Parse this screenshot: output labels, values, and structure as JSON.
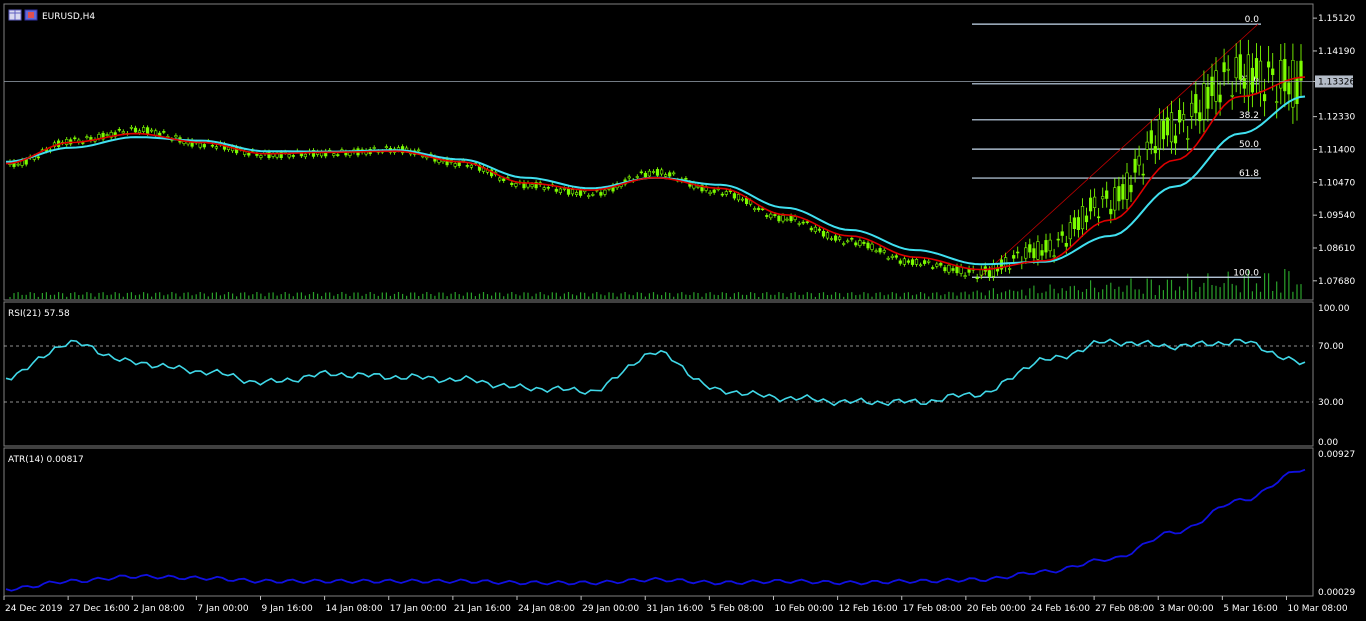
{
  "header": {
    "symbol_label": "EURUSD,H4"
  },
  "colors": {
    "background": "#000000",
    "panel_border": "#808080",
    "candle": "#7CFC00",
    "ma_fast": "#e00000",
    "ma_slow": "#40e0f0",
    "fib": "#c8dcf0",
    "fib_trend": "#c00000",
    "rsi": "#40d8e8",
    "atr": "#1010e0",
    "volume": "#2aa02a"
  },
  "price_panel": {
    "price_ticks": [
      "1.15120",
      "1.14190",
      "1.13326",
      "1.12330",
      "1.11400",
      "1.10470",
      "1.09540",
      "1.08610",
      "1.07680"
    ],
    "current_price": "1.13326",
    "fibonacci_levels": [
      {
        "label": "0.0",
        "price": 1.1495
      },
      {
        "label": "23.6",
        "price": 1.1326
      },
      {
        "label": "38.2",
        "price": 1.1224
      },
      {
        "label": "50.0",
        "price": 1.1141
      },
      {
        "label": "61.8",
        "price": 1.1059
      },
      {
        "label": "100.0",
        "price": 1.0778
      }
    ]
  },
  "rsi_panel": {
    "label": "RSI(21) 57.58",
    "ticks": [
      "100.00",
      "70.00",
      "30.00",
      "0.00"
    ],
    "levels": [
      70,
      30
    ]
  },
  "atr_panel": {
    "label": "ATR(14) 0.00817",
    "ticks": [
      "0.00927",
      "0.00029"
    ]
  },
  "time_axis": {
    "labels": [
      "24 Dec 2019",
      "27 Dec 16:00",
      "2 Jan 08:00",
      "7 Jan 00:00",
      "9 Jan 16:00",
      "14 Jan 08:00",
      "17 Jan 00:00",
      "21 Jan 16:00",
      "24 Jan 08:00",
      "29 Jan 00:00",
      "31 Jan 16:00",
      "5 Feb 08:00",
      "10 Feb 00:00",
      "12 Feb 16:00",
      "17 Feb 08:00",
      "20 Feb 00:00",
      "24 Feb 16:00",
      "27 Feb 08:00",
      "3 Mar 00:00",
      "5 Mar 16:00",
      "10 Mar 08:00"
    ]
  },
  "chart_data": {
    "type": "line",
    "symbol": "EURUSD",
    "timeframe": "H4",
    "x": [
      "24 Dec 2019",
      "27 Dec 16:00",
      "2 Jan 08:00",
      "7 Jan 00:00",
      "9 Jan 16:00",
      "14 Jan 08:00",
      "17 Jan 00:00",
      "21 Jan 16:00",
      "24 Jan 08:00",
      "29 Jan 00:00",
      "31 Jan 16:00",
      "5 Feb 08:00",
      "10 Feb 00:00",
      "12 Feb 16:00",
      "17 Feb 08:00",
      "20 Feb 00:00",
      "24 Feb 16:00",
      "27 Feb 08:00",
      "3 Mar 00:00",
      "5 Mar 16:00",
      "10 Mar 08:00"
    ],
    "price_range": [
      1.0725,
      1.1535
    ],
    "series": [
      {
        "key": "price",
        "values": [
          1.1097,
          1.1165,
          1.1195,
          1.1155,
          1.1125,
          1.113,
          1.114,
          1.11,
          1.104,
          1.1015,
          1.1075,
          1.102,
          1.0945,
          1.088,
          1.082,
          1.079,
          1.0855,
          1.099,
          1.12,
          1.135,
          1.1326
        ]
      },
      {
        "key": "ma_fast",
        "values": [
          1.11,
          1.116,
          1.1185,
          1.116,
          1.1128,
          1.1132,
          1.1135,
          1.1105,
          1.1045,
          1.1025,
          1.106,
          1.103,
          1.0955,
          1.0895,
          1.0835,
          1.08,
          1.0825,
          1.094,
          1.111,
          1.129,
          1.1345
        ]
      },
      {
        "key": "ma_slow",
        "values": [
          1.1105,
          1.1145,
          1.1175,
          1.1165,
          1.1135,
          1.1134,
          1.1138,
          1.1112,
          1.106,
          1.103,
          1.106,
          1.104,
          1.0975,
          1.0912,
          1.0855,
          1.0815,
          1.0822,
          1.0895,
          1.1035,
          1.1185,
          1.129
        ]
      }
    ],
    "rsi": {
      "range": [
        0,
        100
      ],
      "values": [
        48,
        72,
        58,
        52,
        44,
        50,
        48,
        46,
        40,
        38,
        65,
        38,
        33,
        30,
        30,
        36,
        60,
        73,
        70,
        73,
        57.58
      ]
    },
    "atr": {
      "range": [
        0.00029,
        0.00927
      ],
      "values": [
        0.0006,
        0.0011,
        0.0014,
        0.0013,
        0.0011,
        0.0011,
        0.0011,
        0.0011,
        0.001,
        0.001,
        0.0012,
        0.001,
        0.0011,
        0.001,
        0.0011,
        0.0012,
        0.0017,
        0.0025,
        0.0042,
        0.0062,
        0.00817
      ]
    }
  }
}
